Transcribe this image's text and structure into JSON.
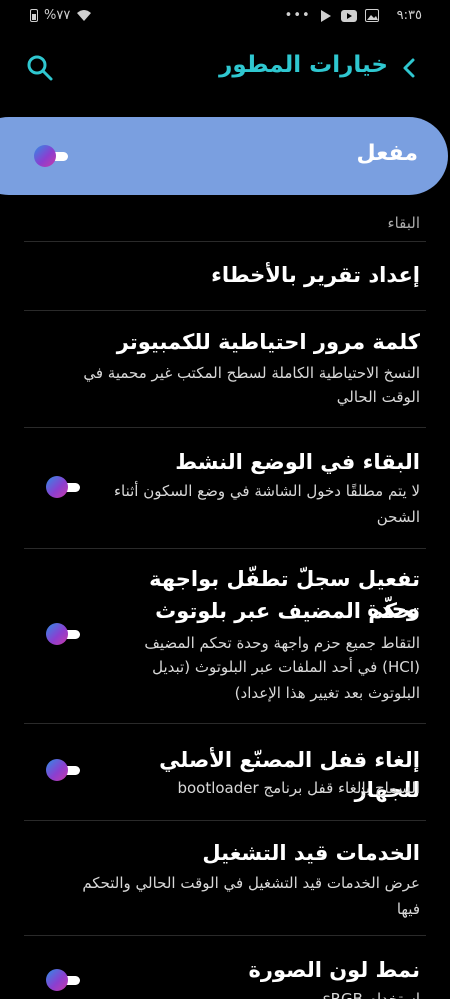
{
  "status_bar": {
    "battery": "%٧٧",
    "time": "٩:٣٥",
    "dots": "•••"
  },
  "header": {
    "title": "خيارات المطور",
    "search_icon": "search-icon",
    "back_icon": "chevron-right-icon"
  },
  "master": {
    "label": "مفعل",
    "on": true
  },
  "cut_row": {
    "text": "البقاء"
  },
  "rows": [
    {
      "title": "إعداد تقرير بالأخطاء",
      "subtitle": "",
      "toggle": false
    },
    {
      "title": "كلمة مرور احتياطية للكمبيوتر",
      "subtitle_line1": "النسخ الاحتياطية الكاملة لسطح المكتب غير محمية في",
      "subtitle_line2": "الوقت الحالي",
      "toggle": false
    },
    {
      "title": "البقاء في الوضع النشط",
      "subtitle_line1": "لا يتم مطلقًا دخول الشاشة في وضع السكون أثناء",
      "subtitle_line2": "الشحن",
      "toggle": true
    },
    {
      "title_line1": "تفعيل سجلّ تطفّل بواجهة وحدة",
      "title_line2": "تحكّم المضيف عبر بلوتوث",
      "subtitle_line1": "التقاط جميع حزم واجهة وحدة تحكم المضيف",
      "subtitle_line2": "(HCI) في أحد الملفات عبر البلوتوث (تبديل",
      "subtitle_line3": "البلوتوث بعد تغيير هذا الإعداد)",
      "toggle": true
    },
    {
      "title": "إلغاء قفل المصنّع الأصلي للجهاز",
      "subtitle_line1": "السماح بإلغاء قفل برنامج bootloader",
      "toggle": true
    },
    {
      "title": "الخدمات قيد التشغيل",
      "subtitle_line1": "عرض الخدمات قيد التشغيل في الوقت الحالي والتحكم",
      "subtitle_line2": "فيها",
      "toggle": false
    },
    {
      "title": "نمط لون الصورة",
      "subtitle_line1": "استخدام sRGB",
      "toggle": true
    }
  ],
  "colors": {
    "accent": "#2fc7d0",
    "master_bg": "#7a9fe0",
    "background": "#000000"
  }
}
